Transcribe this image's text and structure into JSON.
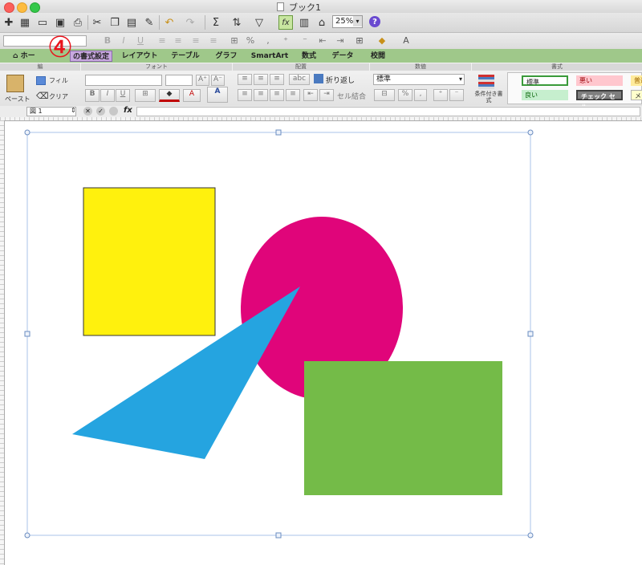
{
  "window": {
    "title": "ブック1"
  },
  "toolbar": {
    "zoom_value": "25%"
  },
  "step_marker": "④",
  "ribbon": {
    "tabs": [
      {
        "label": "ホーム"
      },
      {
        "label": "セルの書式設定"
      },
      {
        "label": "レイアウト"
      },
      {
        "label": "テーブル"
      },
      {
        "label": "グラフ"
      },
      {
        "label": "SmartArt"
      },
      {
        "label": "数式"
      },
      {
        "label": "データ"
      },
      {
        "label": "校閲"
      }
    ],
    "home_tab_visible": "ホー",
    "active_tab_visible": "の書式設定",
    "groups": {
      "edit": "編",
      "font": "フォント",
      "alignment": "配置",
      "number": "数値",
      "format": "書式"
    },
    "paste_label": "ペースト",
    "fill_label": "フィル",
    "clear_label": "クリア",
    "wrap_label": "折り返し",
    "merge_label": "セル結合",
    "number_format_value": "標準",
    "conditional_format_label": "条件付き書式",
    "font_color_label": "A",
    "styles": [
      {
        "label": "標準",
        "bg": "#ffffff",
        "border": "#3a9a3a"
      },
      {
        "label": "悪い",
        "bg": "#ffc7ce",
        "border": "#ffc7ce"
      },
      {
        "label": "普通",
        "bg": "#ffeb9c",
        "border": "#ffeb9c"
      },
      {
        "label": "良い",
        "bg": "#c6efce",
        "border": "#c6efce"
      },
      {
        "label": "チェック セル",
        "bg": "#7f7f7f",
        "border": "#3f3f3f"
      },
      {
        "label": "メモ",
        "bg": "#ffffcc",
        "border": "#b2b2b2"
      }
    ]
  },
  "formula_bar": {
    "cell_reference": "図 1",
    "fx_label": "fx"
  },
  "drawing": {
    "selection_color": "#a9c3e8",
    "shapes": [
      {
        "name": "yellow-rectangle",
        "color": "#fff10d"
      },
      {
        "name": "magenta-ellipse",
        "color": "#e0057a"
      },
      {
        "name": "blue-triangle",
        "color": "#25a4e0"
      },
      {
        "name": "green-rectangle",
        "color": "#74bb48"
      }
    ]
  },
  "colors": {
    "ribbon_tab_bar": "#9fc88a",
    "active_tab": "#c8a8e0",
    "step_marker": "#e8141c"
  }
}
